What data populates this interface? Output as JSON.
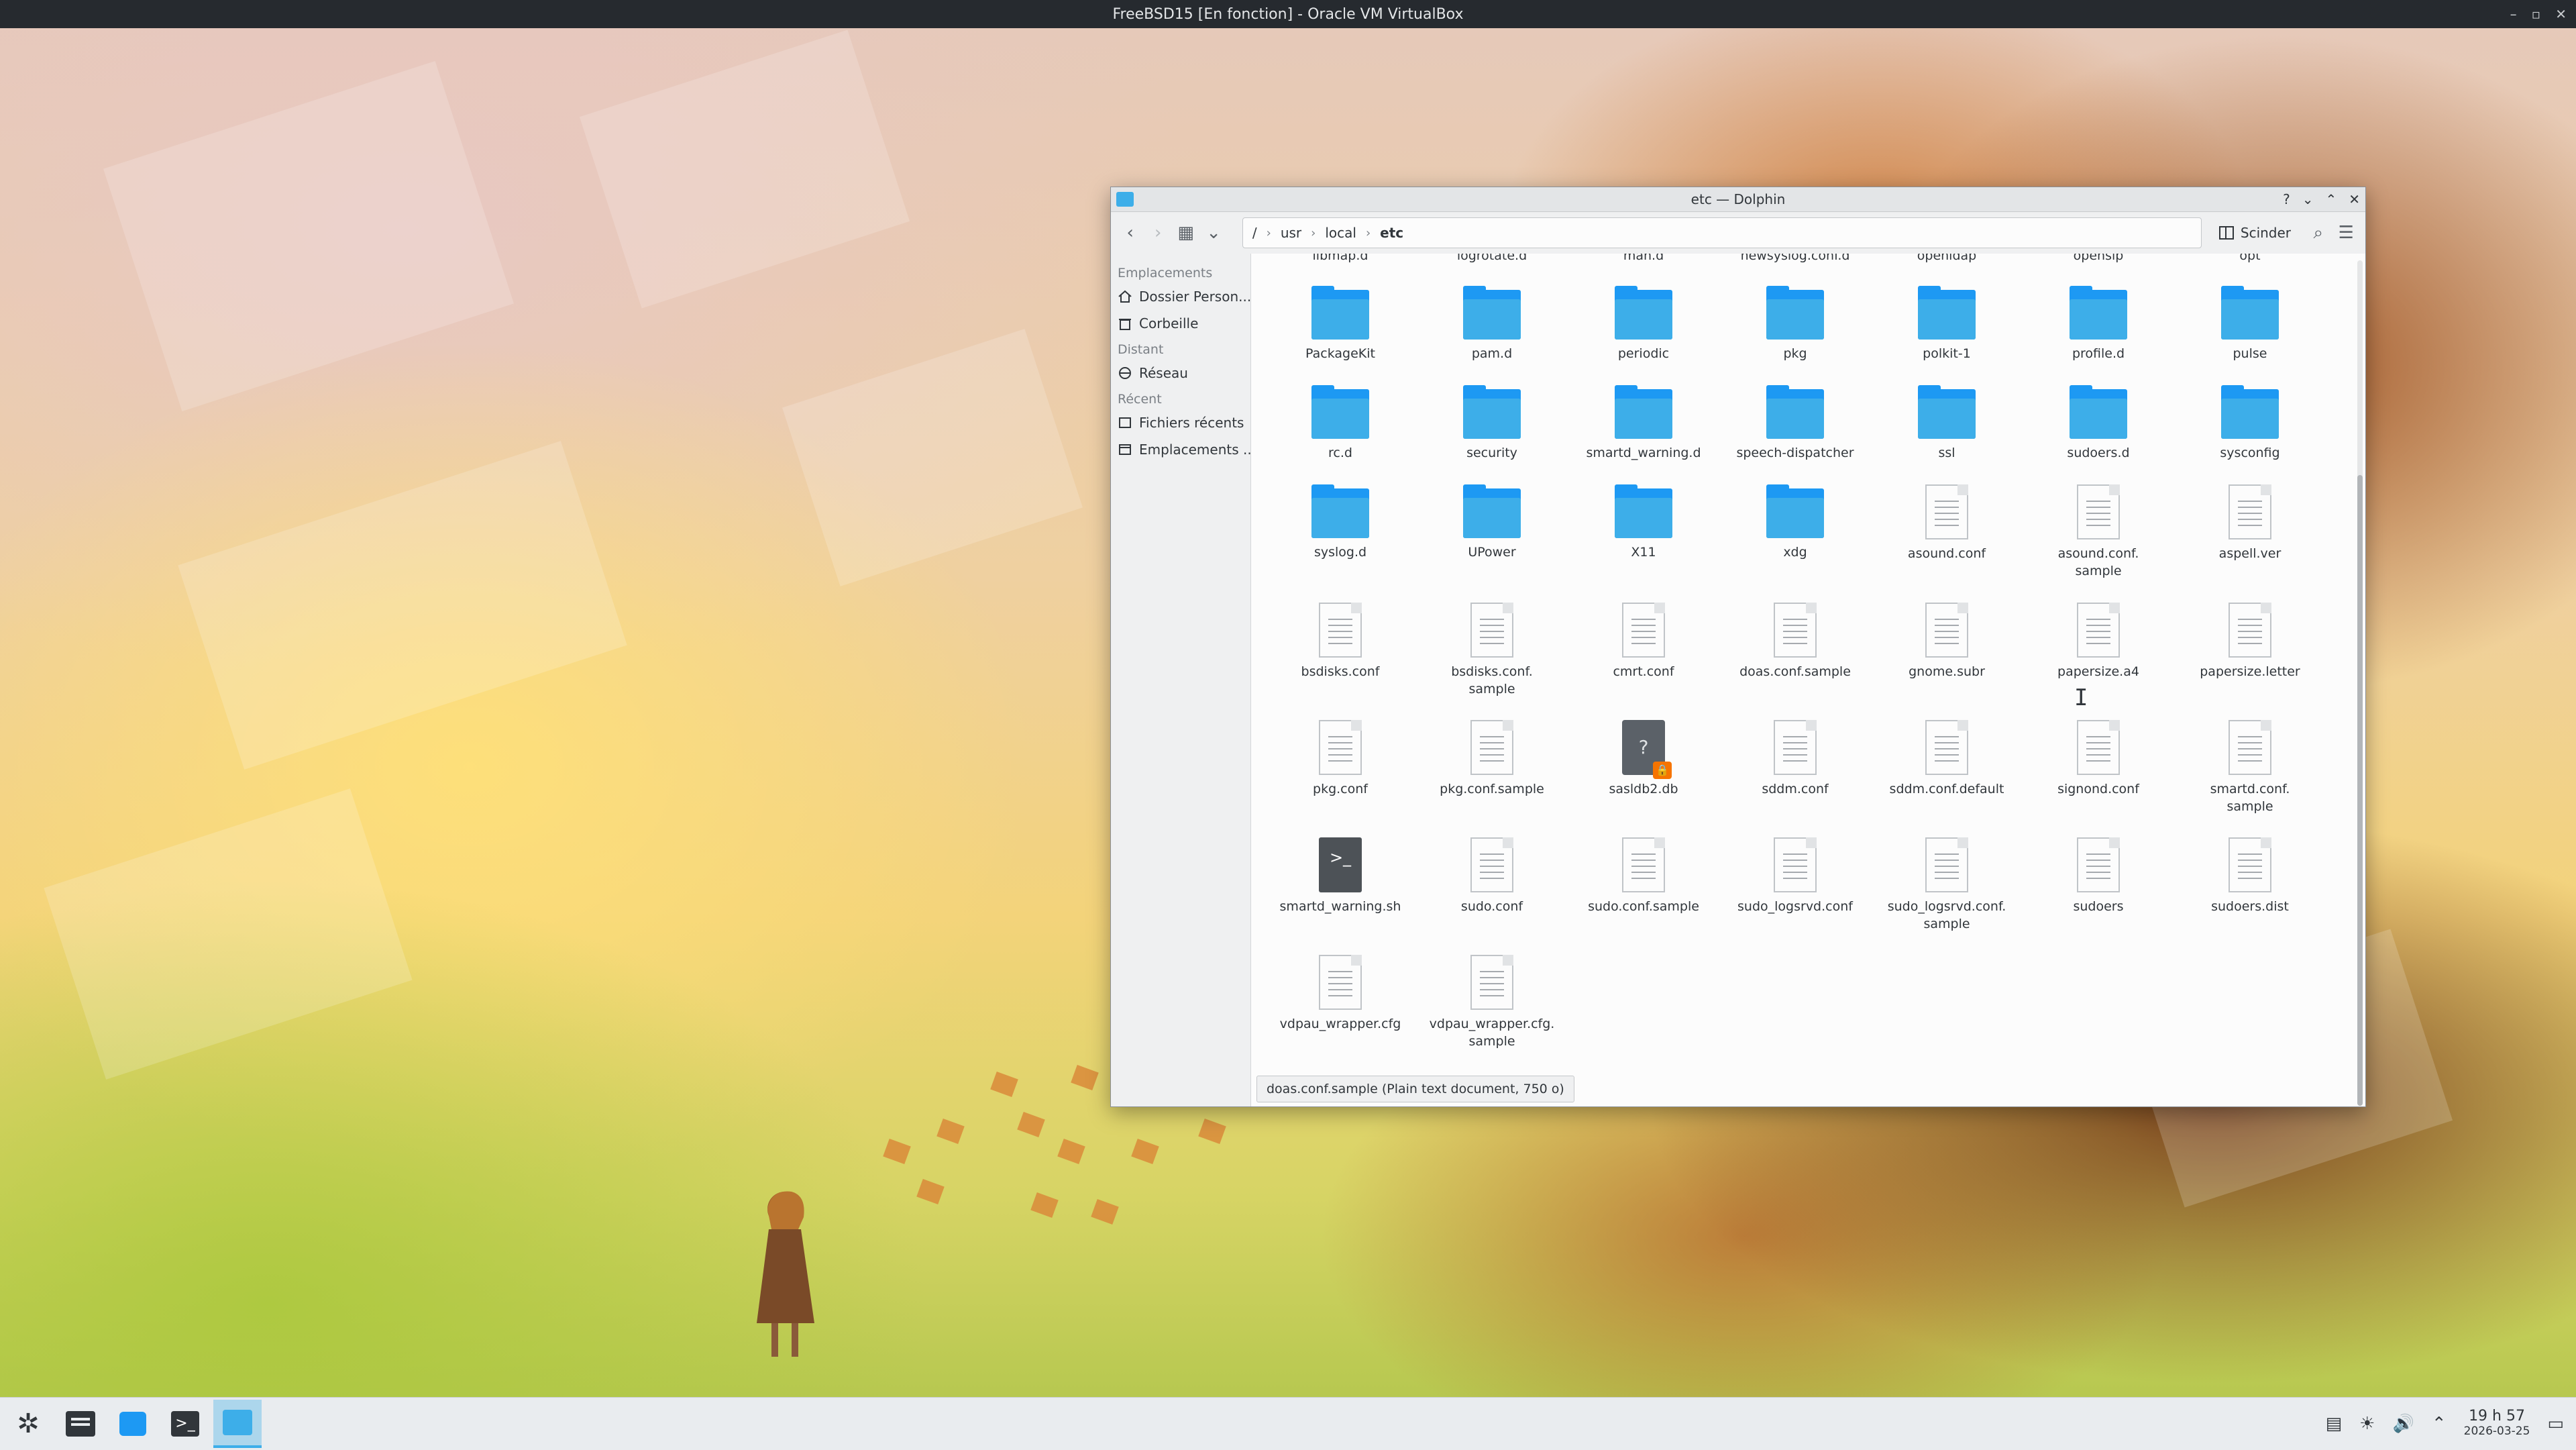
{
  "vbox": {
    "title": "FreeBSD15 [En fonction] - Oracle VM VirtualBox",
    "controls": [
      "–",
      "▫",
      "✕"
    ]
  },
  "dolphin": {
    "title": "etc — Dolphin",
    "title_buttons": [
      "?",
      "⌄",
      "⌃",
      "✕"
    ],
    "breadcrumb": [
      "/",
      "usr",
      "local",
      "etc"
    ],
    "split_label": "Scinder",
    "sidebar": {
      "sections": [
        {
          "title": "Emplacements",
          "items": [
            {
              "label": "Dossier Person...",
              "icon": "home-icon"
            },
            {
              "label": "Corbeille",
              "icon": "trash-icon"
            }
          ]
        },
        {
          "title": "Distant",
          "items": [
            {
              "label": "Réseau",
              "icon": "network-icon"
            }
          ]
        },
        {
          "title": "Récent",
          "items": [
            {
              "label": "Fichiers récents",
              "icon": "recent-files-icon"
            },
            {
              "label": "Emplacements ...",
              "icon": "recent-locations-icon"
            }
          ]
        }
      ]
    },
    "items": [
      {
        "name": "libmap.d",
        "type": "folder",
        "partial": true
      },
      {
        "name": "logrotate.d",
        "type": "folder",
        "partial": true
      },
      {
        "name": "man.d",
        "type": "folder",
        "partial": true
      },
      {
        "name": "newsyslog.conf.d",
        "type": "folder",
        "partial": true
      },
      {
        "name": "openldap",
        "type": "folder",
        "partial": true
      },
      {
        "name": "openslp",
        "type": "folder",
        "partial": true
      },
      {
        "name": "opt",
        "type": "folder",
        "partial": true
      },
      {
        "name": "PackageKit",
        "type": "folder"
      },
      {
        "name": "pam.d",
        "type": "folder"
      },
      {
        "name": "periodic",
        "type": "folder"
      },
      {
        "name": "pkg",
        "type": "folder"
      },
      {
        "name": "polkit-1",
        "type": "folder"
      },
      {
        "name": "profile.d",
        "type": "folder"
      },
      {
        "name": "pulse",
        "type": "folder"
      },
      {
        "name": "rc.d",
        "type": "folder"
      },
      {
        "name": "security",
        "type": "folder"
      },
      {
        "name": "smartd_warning.d",
        "type": "folder"
      },
      {
        "name": "speech-dispatcher",
        "type": "folder"
      },
      {
        "name": "ssl",
        "type": "folder"
      },
      {
        "name": "sudoers.d",
        "type": "folder"
      },
      {
        "name": "sysconfig",
        "type": "folder"
      },
      {
        "name": "syslog.d",
        "type": "folder"
      },
      {
        "name": "UPower",
        "type": "folder"
      },
      {
        "name": "X11",
        "type": "folder"
      },
      {
        "name": "xdg",
        "type": "folder"
      },
      {
        "name": "asound.conf",
        "type": "file"
      },
      {
        "name": "asound.conf.\nsample",
        "type": "file"
      },
      {
        "name": "aspell.ver",
        "type": "file"
      },
      {
        "name": "bsdisks.conf",
        "type": "file"
      },
      {
        "name": "bsdisks.conf.\nsample",
        "type": "file"
      },
      {
        "name": "cmrt.conf",
        "type": "file"
      },
      {
        "name": "doas.conf.sample",
        "type": "file"
      },
      {
        "name": "gnome.subr",
        "type": "file"
      },
      {
        "name": "papersize.a4",
        "type": "file"
      },
      {
        "name": "papersize.letter",
        "type": "file"
      },
      {
        "name": "pkg.conf",
        "type": "file"
      },
      {
        "name": "pkg.conf.sample",
        "type": "file"
      },
      {
        "name": "sasldb2.db",
        "type": "db"
      },
      {
        "name": "sddm.conf",
        "type": "file"
      },
      {
        "name": "sddm.conf.default",
        "type": "file"
      },
      {
        "name": "signond.conf",
        "type": "file"
      },
      {
        "name": "smartd.conf.\nsample",
        "type": "file"
      },
      {
        "name": "smartd_warning.sh",
        "type": "script"
      },
      {
        "name": "sudo.conf",
        "type": "file"
      },
      {
        "name": "sudo.conf.sample",
        "type": "file"
      },
      {
        "name": "sudo_logsrvd.conf",
        "type": "file"
      },
      {
        "name": "sudo_logsrvd.conf.\nsample",
        "type": "file"
      },
      {
        "name": "sudoers",
        "type": "file"
      },
      {
        "name": "sudoers.dist",
        "type": "file"
      },
      {
        "name": "vdpau_wrapper.cfg",
        "type": "file"
      },
      {
        "name": "vdpau_wrapper.cfg.\nsample",
        "type": "file"
      }
    ],
    "status": "doas.conf.sample (Plain text document, 750 o)"
  },
  "taskbar": {
    "apps": [
      "launcher-icon",
      "system-settings-icon",
      "discover-store-icon",
      "konsole-icon",
      "dolphin-icon"
    ],
    "clock_time": "19 h 57",
    "clock_date": "2026-03-25"
  },
  "colors": {
    "accent": "#3daee9",
    "folder": "#1d99f3",
    "lock_badge": "#f67400"
  }
}
